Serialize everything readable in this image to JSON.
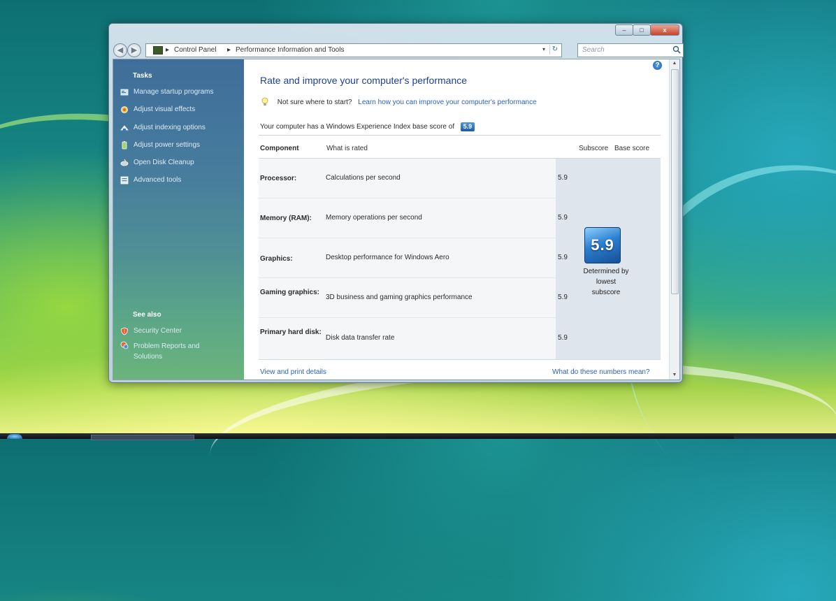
{
  "window": {
    "caption_buttons": [
      {
        "name": "minimize-button",
        "glyph": "–"
      },
      {
        "name": "maximize-button",
        "glyph": "□"
      },
      {
        "name": "close-button",
        "glyph": "x"
      }
    ]
  },
  "nav": {
    "back_glyph": "◀",
    "forward_glyph": "▶",
    "breadcrumbs": [
      "Control Panel",
      "Performance Information and Tools"
    ],
    "separator": "▸",
    "dropdown_glyph": "▾",
    "refresh_glyph": "↻",
    "search_placeholder": "Search"
  },
  "sidebar": {
    "tasks_heading": "Tasks",
    "tasks": [
      {
        "label": "Manage startup programs",
        "icon": "startup-programs-icon"
      },
      {
        "label": "Adjust visual effects",
        "icon": "visual-effects-icon"
      },
      {
        "label": "Adjust indexing options",
        "icon": "indexing-options-icon"
      },
      {
        "label": "Adjust power settings",
        "icon": "power-settings-icon"
      },
      {
        "label": "Open Disk Cleanup",
        "icon": "disk-cleanup-icon"
      },
      {
        "label": "Advanced tools",
        "icon": "advanced-tools-icon"
      }
    ],
    "see_also_heading": "See also",
    "see_also": [
      {
        "label": "Security Center",
        "icon": "security-center-icon"
      },
      {
        "label": "Problem Reports and Solutions",
        "icon": "problem-reports-icon"
      }
    ]
  },
  "main": {
    "title": "Rate and improve your computer's performance",
    "tip_text": "Not sure where to start?",
    "tip_link": "Learn how you can improve your computer's performance",
    "base_score_text": "Your computer has a Windows Experience Index base score of",
    "base_score": "5.9",
    "headers": {
      "component": "Component",
      "what_is_rated": "What is rated",
      "subscore": "Subscore",
      "base_score": "Base score"
    },
    "rows": [
      {
        "component": "Processor:",
        "what": "Calculations per second",
        "subscore": "5.9"
      },
      {
        "component": "Memory (RAM):",
        "what": "Memory operations per second",
        "subscore": "5.9"
      },
      {
        "component": "Graphics:",
        "what": "Desktop performance for Windows Aero",
        "subscore": "5.9"
      },
      {
        "component": "Gaming graphics:",
        "what": "3D business and gaming graphics performance",
        "subscore": "5.9"
      },
      {
        "component": "Primary hard disk:",
        "what": "Disk data transfer rate",
        "subscore": "5.9"
      }
    ],
    "score_caption": "Determined by lowest subscore",
    "footer_left": "View and print details",
    "footer_right": "What do these numbers mean?",
    "help_glyph": "?"
  },
  "scrollbar": {
    "up_glyph": "▲",
    "down_glyph": "▼"
  },
  "colors": {
    "link": "#2b63b8",
    "title": "#1e3f9a",
    "sidebar_top": "#3f6e9a",
    "sidebar_bottom": "#6bb47c",
    "score_badge": "#2c7fd0"
  }
}
